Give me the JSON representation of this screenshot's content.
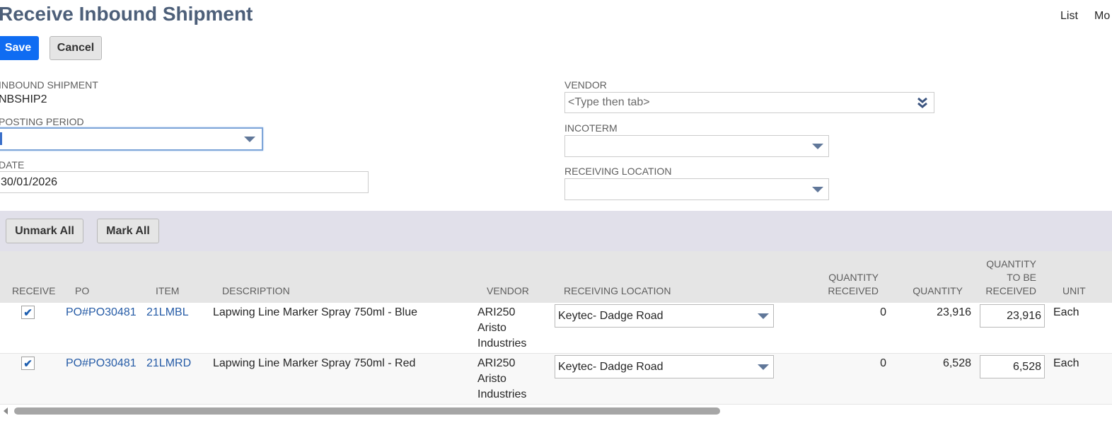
{
  "page": {
    "title": "Receive Inbound Shipment",
    "links": [
      "List",
      "Mo"
    ]
  },
  "actions": {
    "save_label": "Save",
    "cancel_label": "Cancel",
    "unmark_all_label": "Unmark All",
    "mark_all_label": "Mark All"
  },
  "form": {
    "inbound_shipment": {
      "label": "INBOUND SHIPMENT",
      "value": "NBSHIP2"
    },
    "posting_period": {
      "label": "POSTING PERIOD",
      "value": ""
    },
    "date": {
      "label": "DATE",
      "value": "30/01/2026"
    },
    "vendor": {
      "label": "VENDOR",
      "placeholder": "<Type then tab>"
    },
    "incoterm": {
      "label": "INCOTERM",
      "value": ""
    },
    "receiving_location": {
      "label": "RECEIVING LOCATION",
      "value": ""
    }
  },
  "table": {
    "headers": {
      "receive": "RECEIVE",
      "po": "PO",
      "item": "ITEM",
      "description": "DESCRIPTION",
      "vendor": "VENDOR",
      "receiving_location": "RECEIVING LOCATION",
      "quantity_received_1": "QUANTITY",
      "quantity_received_2": "RECEIVED",
      "quantity": "QUANTITY",
      "qty_to_be_received_1": "QUANTITY",
      "qty_to_be_received_2": "TO BE",
      "qty_to_be_received_3": "RECEIVED",
      "unit": "UNIT"
    },
    "rows": [
      {
        "checked": true,
        "check_glyph": "✔",
        "po": "PO#PO30481",
        "item": "21LMBL",
        "description": "Lapwing Line Marker Spray 750ml - Blue",
        "vendor_line1": "ARI250",
        "vendor_line2": "Aristo",
        "vendor_line3": "Industries",
        "receiving_location": "Keytec- Dadge Road",
        "quantity_received": "0",
        "quantity": "23,916",
        "quantity_to_be_received": "23,916",
        "unit": "Each"
      },
      {
        "checked": true,
        "check_glyph": "✔",
        "po": "PO#PO30481",
        "item": "21LMRD",
        "description": "Lapwing Line Marker Spray 750ml - Red",
        "vendor_line1": "ARI250",
        "vendor_line2": "Aristo",
        "vendor_line3": "Industries",
        "receiving_location": "Keytec- Dadge Road",
        "quantity_received": "0",
        "quantity": "6,528",
        "quantity_to_be_received": "6,528",
        "unit": "Each"
      }
    ]
  },
  "colors": {
    "title": "#4d5f79",
    "primary_button": "#0f6cf2",
    "link": "#255ba6",
    "band": "#e1e0ea",
    "table_header": "#e5e5e5"
  }
}
